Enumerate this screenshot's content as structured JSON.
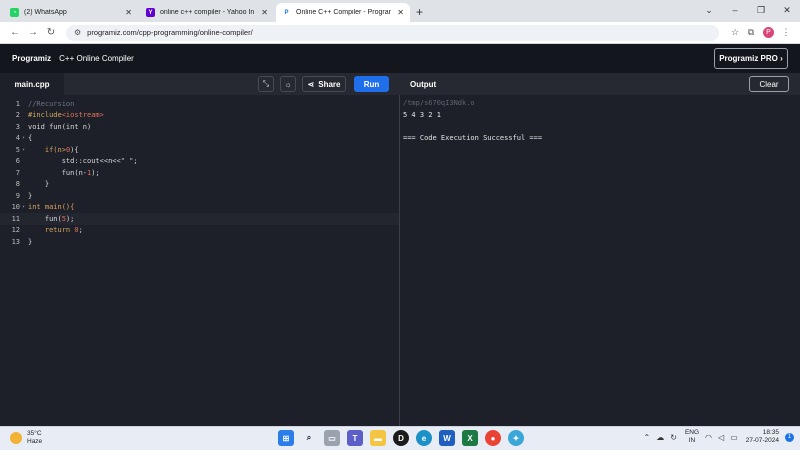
{
  "browser": {
    "tabs": [
      {
        "title": "(2) WhatsApp",
        "fav_color": "#25d366",
        "fav_glyph": "◔"
      },
      {
        "title": "online c++ compiler - Yahoo In",
        "fav_color": "#6001d2",
        "fav_glyph": "Y"
      },
      {
        "title": "Online C++ Compiler - Prograr",
        "fav_color": "#ffffff",
        "fav_glyph": "P"
      }
    ],
    "new_tab": "+",
    "url": "programiz.com/cpp-programming/online-compiler/",
    "profile_initial": "P"
  },
  "app": {
    "logo": "Programiz",
    "title": "C++ Online Compiler",
    "pro_button": "Programiz PRO ›"
  },
  "editor": {
    "file_tab": "main.cpp",
    "share_label": "Share",
    "run_label": "Run",
    "lines": [
      {
        "n": "1",
        "fold": ""
      },
      {
        "n": "2",
        "fold": ""
      },
      {
        "n": "3",
        "fold": ""
      },
      {
        "n": "4",
        "fold": "▾"
      },
      {
        "n": "5",
        "fold": "▾"
      },
      {
        "n": "6",
        "fold": ""
      },
      {
        "n": "7",
        "fold": ""
      },
      {
        "n": "8",
        "fold": ""
      },
      {
        "n": "9",
        "fold": ""
      },
      {
        "n": "10",
        "fold": "▾"
      },
      {
        "n": "11",
        "fold": ""
      },
      {
        "n": "12",
        "fold": ""
      },
      {
        "n": "13",
        "fold": ""
      }
    ],
    "code": {
      "l1": "//Recursion",
      "l2_pre": "#include",
      "l2_inc": "<iostream>",
      "l3": "void fun(int n)",
      "l4": "{",
      "l5_a": "    if(n>",
      "l5_num": "0",
      "l5_b": "){",
      "l6_a": "        std::cout<<n<<",
      "l6_str": "\" \"",
      "l6_b": ";",
      "l7_a": "        fun(n-",
      "l7_num": "1",
      "l7_b": ");",
      "l8": "    }",
      "l9": "}",
      "l10": "int main(){",
      "l11_a": "    fun(",
      "l11_num": "5",
      "l11_b": ");",
      "l12_a": "    return ",
      "l12_num": "0",
      "l12_b": ";",
      "l13": "}"
    }
  },
  "output": {
    "header": "Output",
    "clear_label": "Clear",
    "path": "/tmp/s670qI3Ndk.o",
    "result": "5 4 3 2 1",
    "status": "=== Code Execution Successful ==="
  },
  "taskbar": {
    "temp": "35°C",
    "condition": "Haze",
    "lang_top": "ENG",
    "lang_bottom": "IN",
    "time": "18:35",
    "date": "27-07-2024",
    "notif_count": "1"
  }
}
